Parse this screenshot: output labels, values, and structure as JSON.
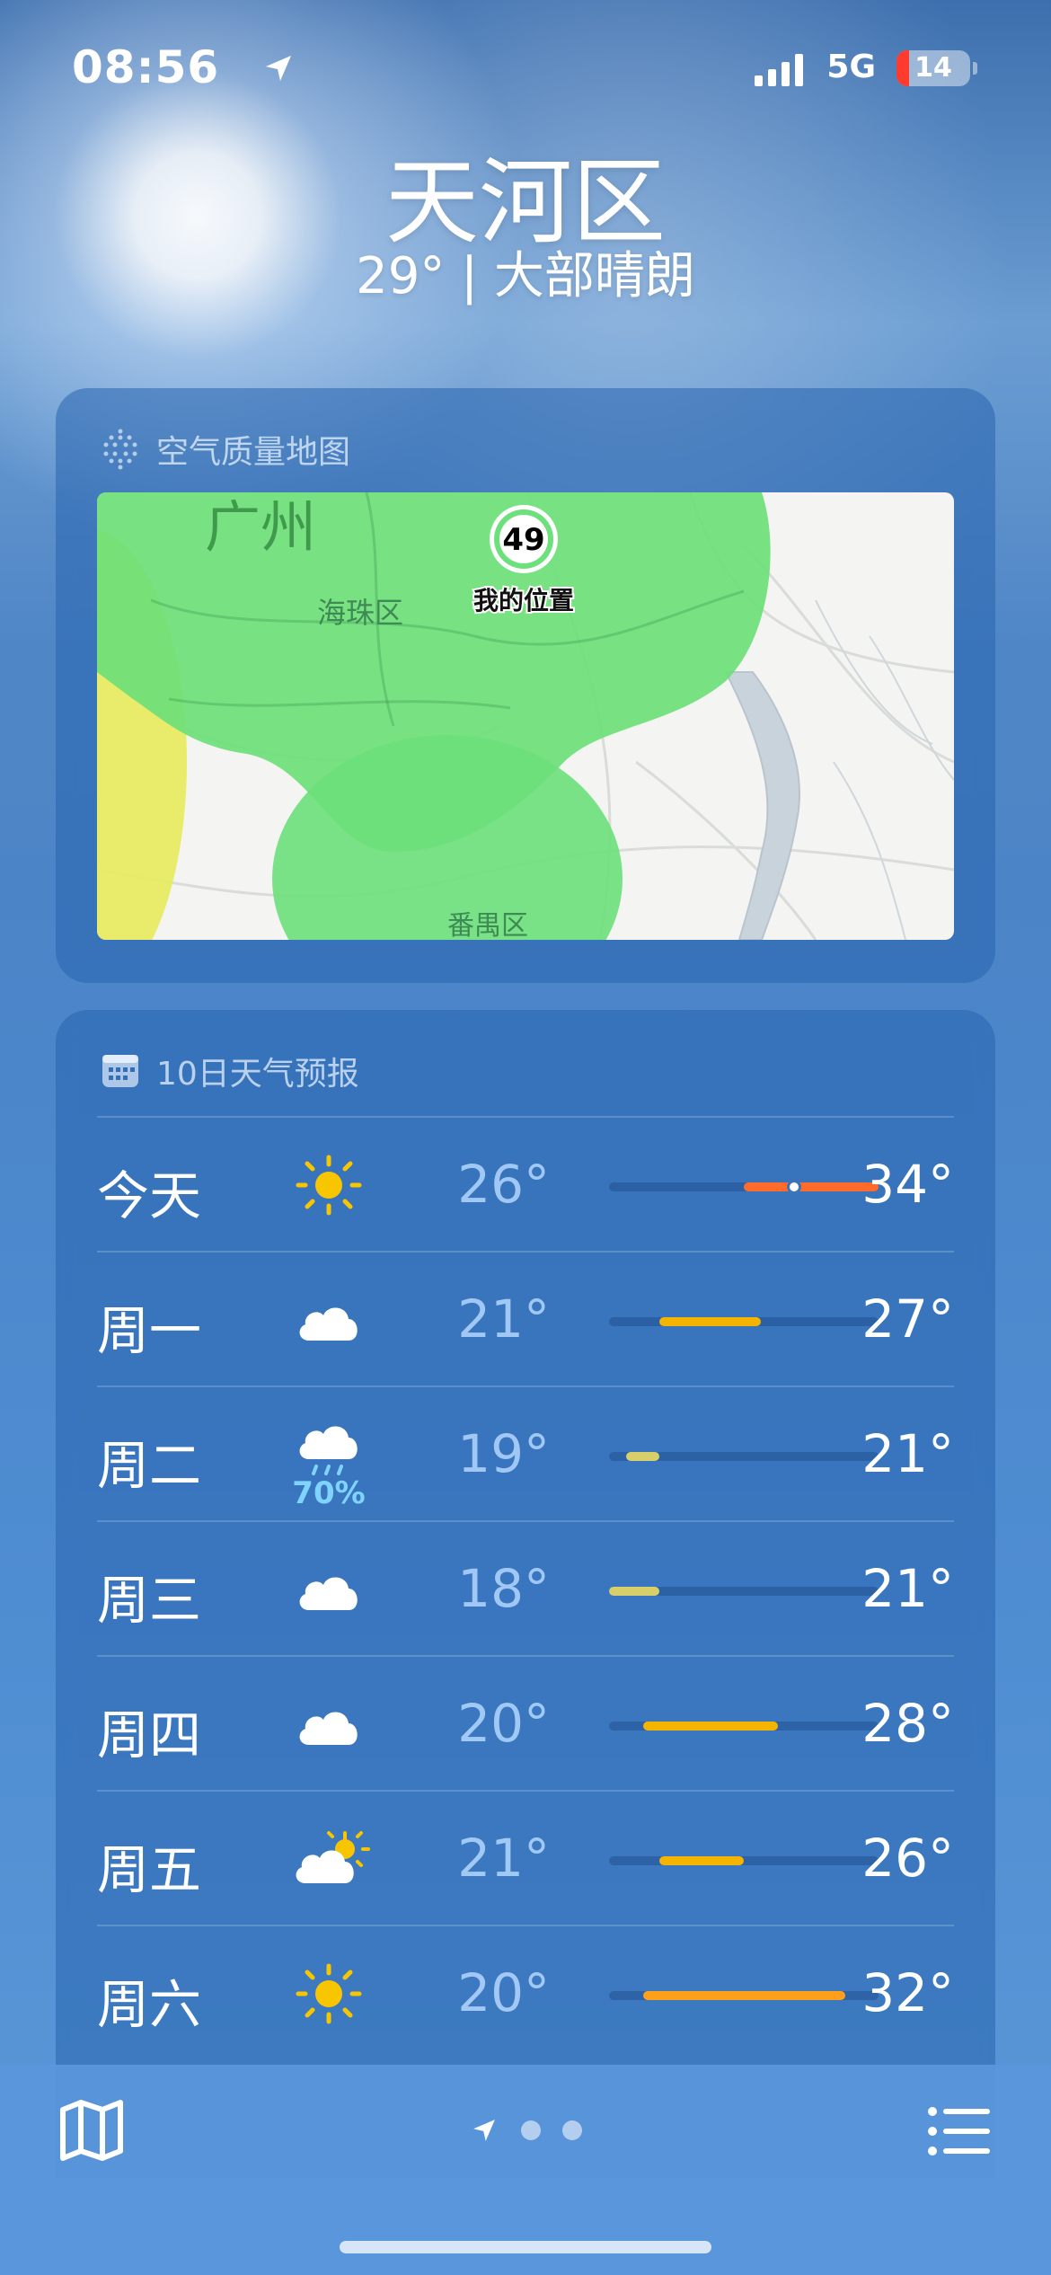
{
  "status_bar": {
    "time": "08:56",
    "network": "5G",
    "battery": "14"
  },
  "location": {
    "name": "天河区",
    "condition": "29° | 大部晴朗"
  },
  "air_quality": {
    "title": "空气质量地图",
    "map_labels": {
      "city": "广州",
      "district_1": "海珠区",
      "district_2": "番禺区",
      "my_location": "我的位置"
    },
    "aqi": "49"
  },
  "forecast": {
    "title": "10日天气预报",
    "range": {
      "min": 18,
      "max": 34
    },
    "days": [
      {
        "day": "今天",
        "icon": "sun-icon",
        "low": "26°",
        "high": "34°",
        "low_v": 26,
        "high_v": 34,
        "current_v": 29,
        "bar_color": "#ff6b2b",
        "pop": ""
      },
      {
        "day": "周一",
        "icon": "cloud-icon",
        "low": "21°",
        "high": "27°",
        "low_v": 21,
        "high_v": 27,
        "bar_color": "#f5b400",
        "pop": ""
      },
      {
        "day": "周二",
        "icon": "rain-cloud-icon",
        "low": "19°",
        "high": "21°",
        "low_v": 19,
        "high_v": 21,
        "bar_color": "#d8cf6b",
        "pop": "70%"
      },
      {
        "day": "周三",
        "icon": "cloud-icon",
        "low": "18°",
        "high": "21°",
        "low_v": 18,
        "high_v": 21,
        "bar_color": "#d8cf6b",
        "pop": ""
      },
      {
        "day": "周四",
        "icon": "cloud-icon",
        "low": "20°",
        "high": "28°",
        "low_v": 20,
        "high_v": 28,
        "bar_color": "#f5b400",
        "pop": ""
      },
      {
        "day": "周五",
        "icon": "partly-sunny-icon",
        "low": "21°",
        "high": "26°",
        "low_v": 21,
        "high_v": 26,
        "bar_color": "#f5b400",
        "pop": ""
      },
      {
        "day": "周六",
        "icon": "sun-icon",
        "low": "20°",
        "high": "32°",
        "low_v": 20,
        "high_v": 32,
        "bar_color": "#ff9f1a",
        "pop": ""
      }
    ]
  },
  "colors": {
    "accent_blue": "#7fd4ff",
    "aqi_green": "#6ce07a",
    "aqi_yellow": "#e8ea5c"
  }
}
